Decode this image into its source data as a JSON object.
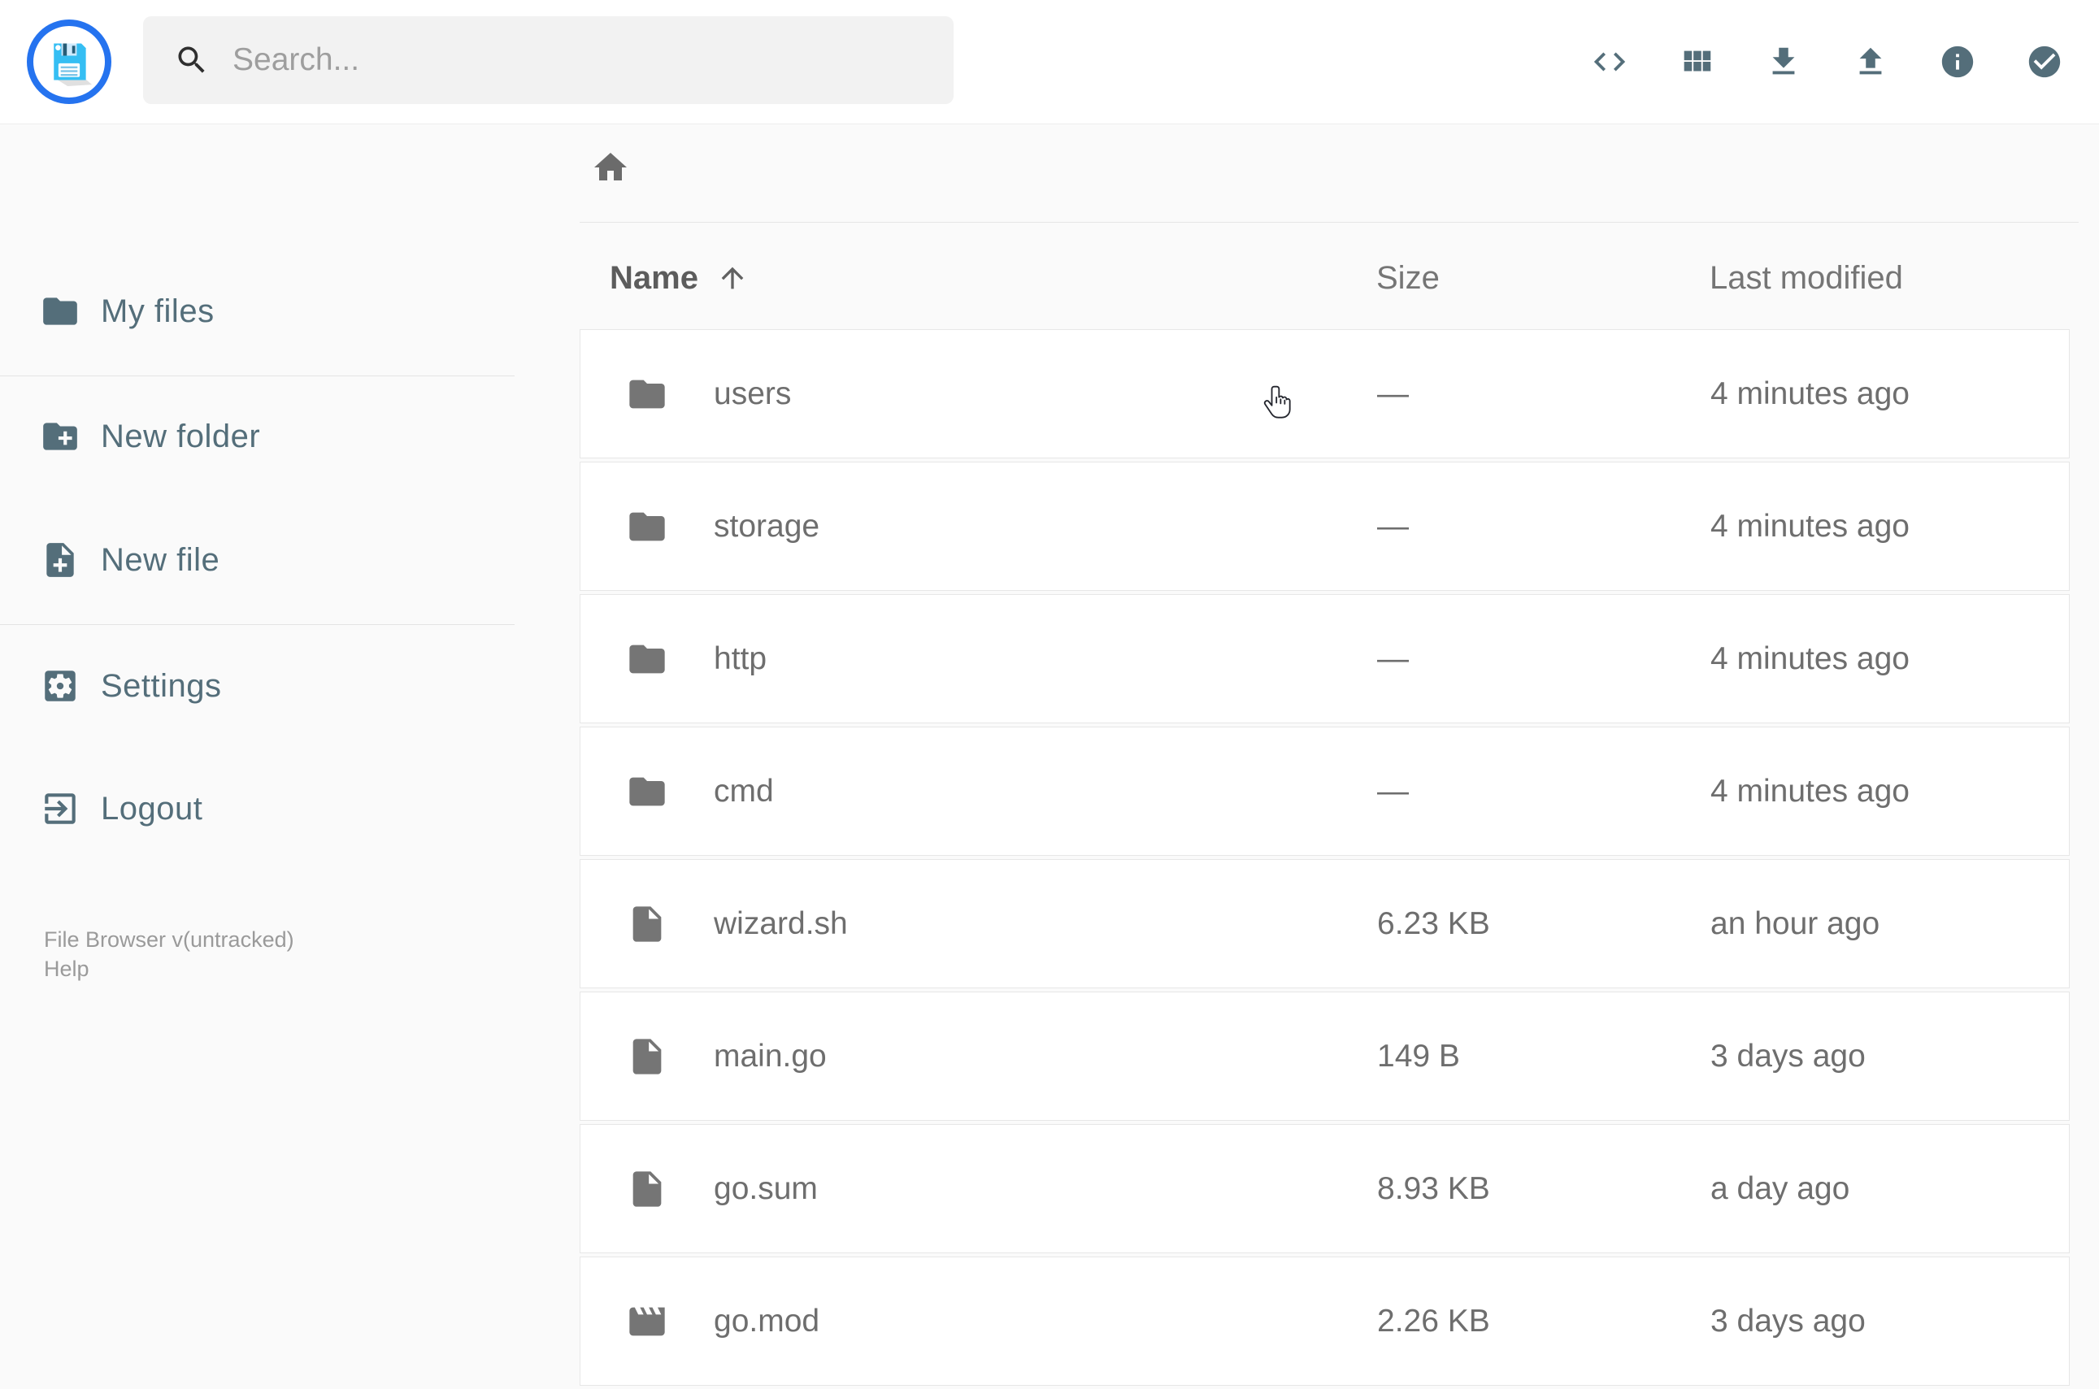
{
  "topbar": {
    "search": {
      "placeholder": "Search..."
    },
    "action_icons": [
      "code",
      "view-grid",
      "download",
      "upload",
      "info",
      "check-circle"
    ]
  },
  "sidebar": {
    "items": [
      {
        "label": "My files",
        "icon": "folder"
      },
      {
        "label": "New folder",
        "icon": "create-new-folder"
      },
      {
        "label": "New file",
        "icon": "note-add"
      },
      {
        "label": "Settings",
        "icon": "settings"
      },
      {
        "label": "Logout",
        "icon": "exit-to-app"
      }
    ],
    "footer": {
      "version": "File Browser v(untracked)",
      "help_label": "Help"
    }
  },
  "breadcrumb": {
    "icons": [
      "home"
    ]
  },
  "listing": {
    "headers": {
      "name": "Name",
      "size": "Size",
      "modified": "Last modified"
    },
    "sort": {
      "column": "name",
      "direction": "ascending",
      "icon": "arrow-up"
    },
    "rows": [
      {
        "name": "users",
        "type": "folder",
        "size": "—",
        "modified": "4 minutes ago"
      },
      {
        "name": "storage",
        "type": "folder",
        "size": "—",
        "modified": "4 minutes ago"
      },
      {
        "name": "http",
        "type": "folder",
        "size": "—",
        "modified": "4 minutes ago"
      },
      {
        "name": "cmd",
        "type": "folder",
        "size": "—",
        "modified": "4 minutes ago"
      },
      {
        "name": "wizard.sh",
        "type": "file",
        "size": "6.23 KB",
        "modified": "an hour ago"
      },
      {
        "name": "main.go",
        "type": "file",
        "size": "149 B",
        "modified": "3 days ago"
      },
      {
        "name": "go.sum",
        "type": "file",
        "size": "8.93 KB",
        "modified": "a day ago"
      },
      {
        "name": "go.mod",
        "type": "movie",
        "size": "2.26 KB",
        "modified": "3 days ago"
      }
    ]
  },
  "colors": {
    "accent_blue": "#2573ef",
    "logo_floppy_blue": "#35bef3",
    "slate_icon": "#546e7a",
    "list_icon_gray": "#757575",
    "text_gray": "#6e6e6e",
    "page_bg": "#fafafa",
    "card_bg": "#ffffff"
  }
}
